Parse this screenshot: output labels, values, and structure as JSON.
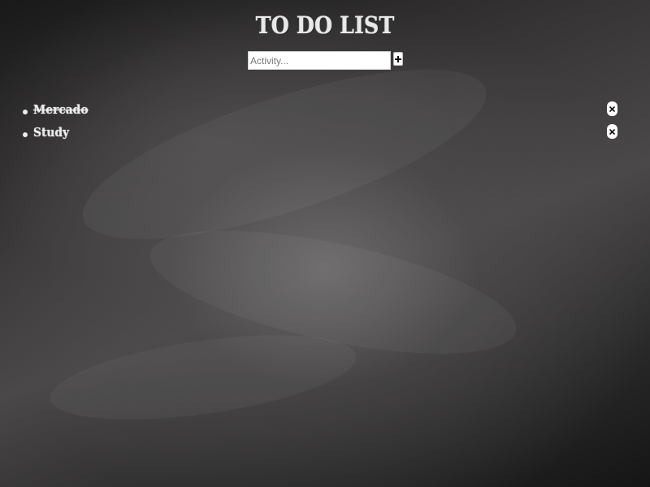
{
  "header": {
    "title": "TO DO LIST"
  },
  "add_form": {
    "placeholder": "Activity...",
    "value": "",
    "add_icon": "plus-icon"
  },
  "todos": [
    {
      "text": "Mercado",
      "completed": true,
      "remove_icon": "close-icon"
    },
    {
      "text": "Study",
      "completed": false,
      "remove_icon": "close-icon"
    }
  ],
  "colors": {
    "background": "#2b2a2a",
    "chalk_text": "#ececec",
    "input_background": "#ffffff"
  }
}
